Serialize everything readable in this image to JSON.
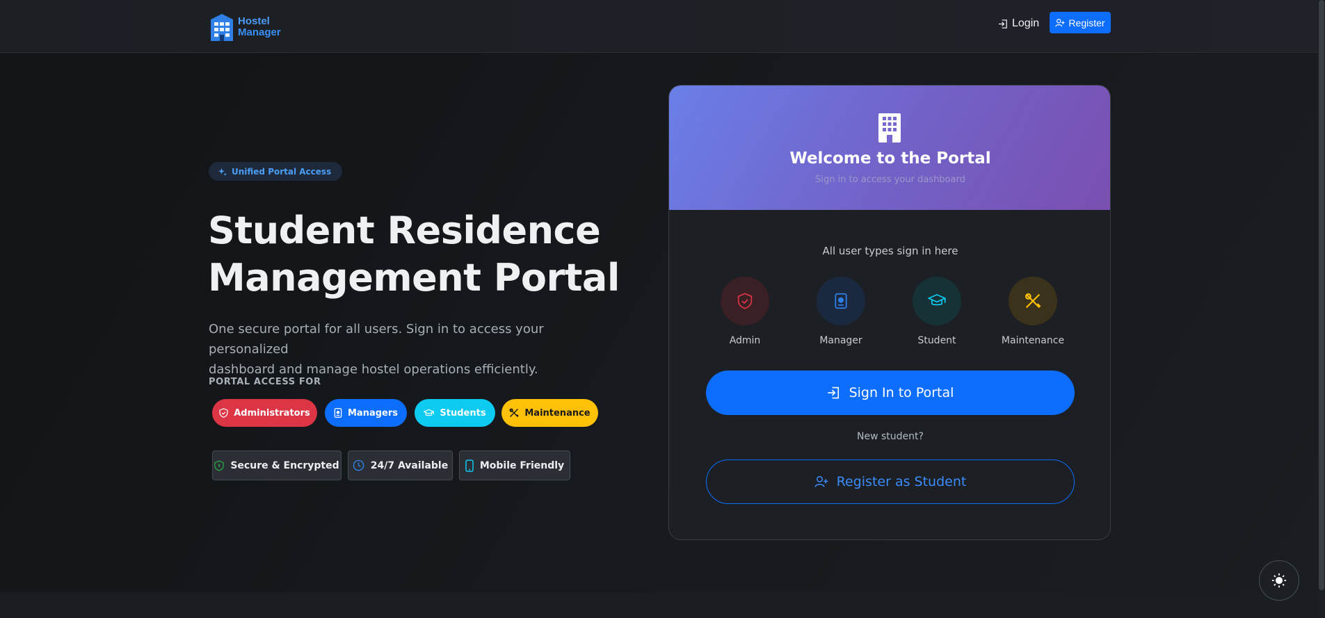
{
  "navbar": {
    "brand_line1": "Hostel",
    "brand_line2": "Manager",
    "login_label": "Login",
    "register_label": "Register"
  },
  "hero": {
    "badge": "Unified Portal Access",
    "title_line1": "Student Residence",
    "title_line2": "Management Portal",
    "subtitle_line1": "One secure portal for all users. Sign in to access your personalized",
    "subtitle_line2": "dashboard and manage hostel operations efficiently.",
    "portal_access_label": "PORTAL ACCESS FOR",
    "chips": [
      {
        "label": "Administrators",
        "icon": "shield-check-icon",
        "color": "#dc3545"
      },
      {
        "label": "Managers",
        "icon": "id-badge-icon",
        "color": "#0d6efd"
      },
      {
        "label": "Students",
        "icon": "mortarboard-icon",
        "color": "#0dcaf0"
      },
      {
        "label": "Maintenance",
        "icon": "tools-icon",
        "color": "#ffc107"
      }
    ],
    "features": [
      {
        "label": "Secure & Encrypted",
        "icon": "shield-icon"
      },
      {
        "label": "24/7 Available",
        "icon": "clock-icon"
      },
      {
        "label": "Mobile Friendly",
        "icon": "phone-icon"
      }
    ]
  },
  "card": {
    "title": "Welcome to the Portal",
    "subtitle": "Sign in to access your dashboard",
    "note": "All user types sign in here",
    "roles": [
      {
        "label": "Admin",
        "icon": "shield-check-icon",
        "color": "#dc3545"
      },
      {
        "label": "Manager",
        "icon": "id-badge-icon",
        "color": "#0d6efd"
      },
      {
        "label": "Student",
        "icon": "mortarboard-icon",
        "color": "#0dcaf0"
      },
      {
        "label": "Maintenance",
        "icon": "tools-icon",
        "color": "#ffc107"
      }
    ],
    "signin_label": "Sign In to Portal",
    "new_student_label": "New student?",
    "register_label": "Register as Student"
  },
  "colors": {
    "primary": "#0d6efd",
    "danger": "#dc3545",
    "info": "#0dcaf0",
    "warning": "#ffc107",
    "header_gradient_start": "#6a7fe8",
    "header_gradient_end": "#7a4fb0"
  }
}
